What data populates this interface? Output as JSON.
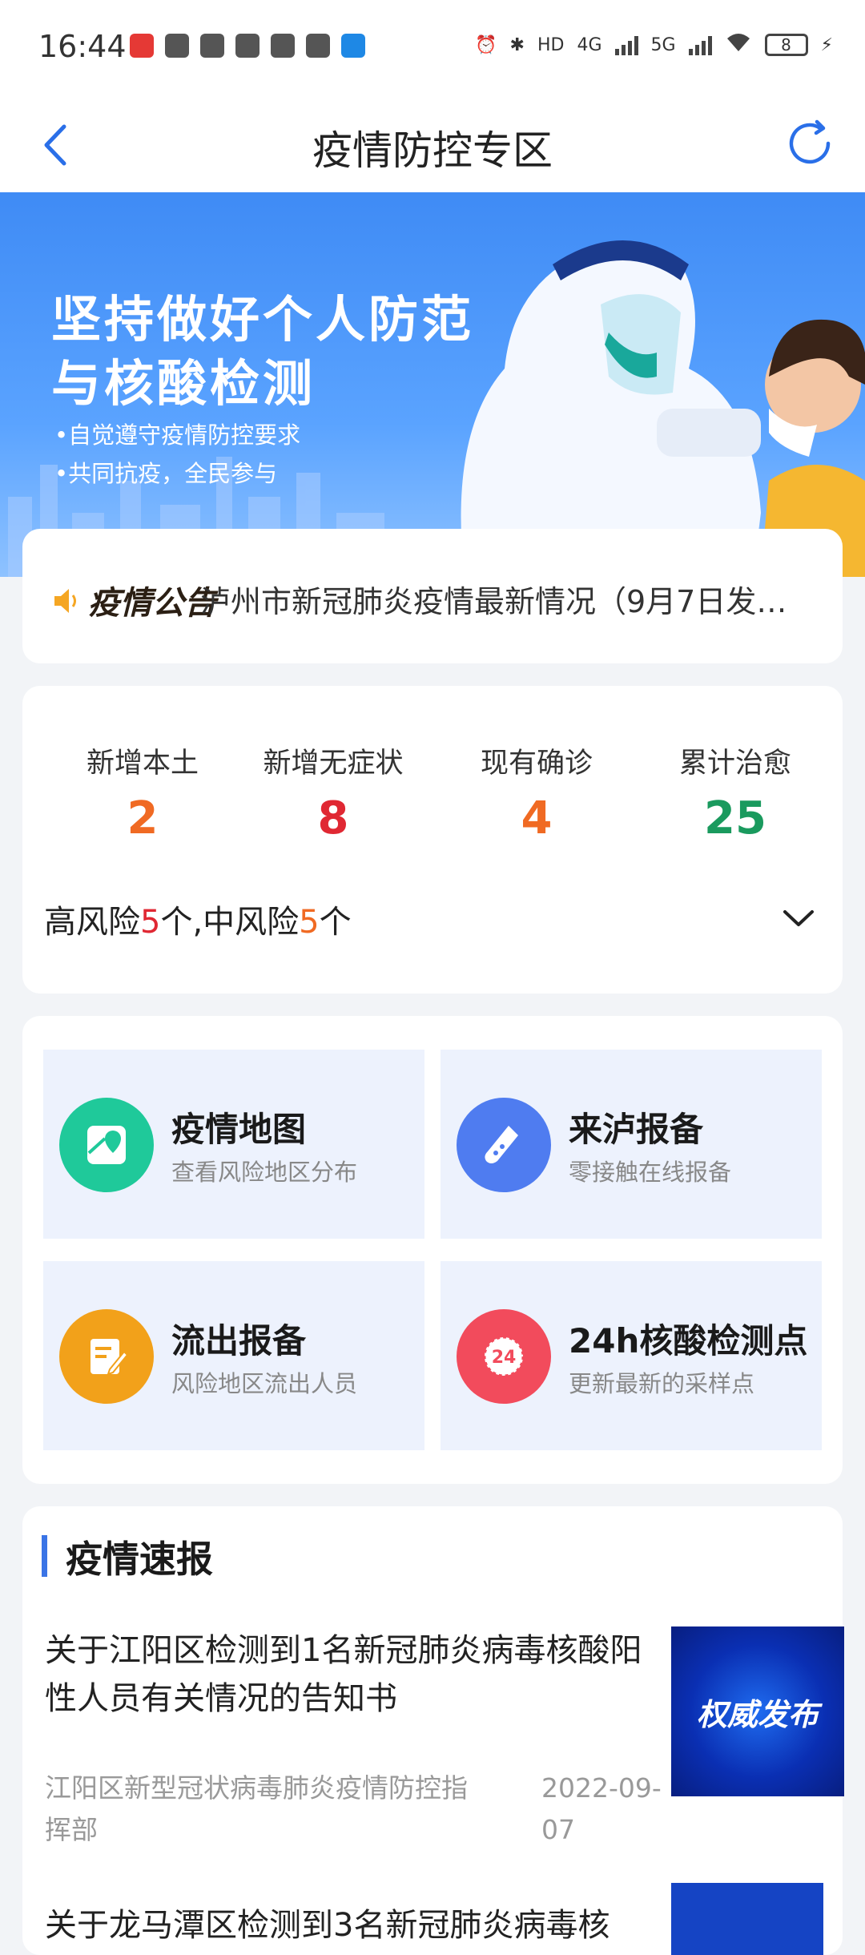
{
  "status_bar": {
    "time": "16:44",
    "battery": "8",
    "network_1": "HD",
    "network_2": "4G",
    "network_3": "5G"
  },
  "header": {
    "title": "疫情防控专区"
  },
  "banner": {
    "headline_1": "坚持做好个人防范",
    "headline_2": "与核酸检测",
    "bullet_1": "•自觉遵守疫情防控要求",
    "bullet_2": "•共同抗疫，全民参与"
  },
  "notice": {
    "label": "疫情公告",
    "text": "泸州市新冠肺炎疫情最新情况（9月7日发…"
  },
  "stats": {
    "items": [
      {
        "label": "新增本土",
        "value": "2",
        "color": "#f06a23"
      },
      {
        "label": "新增无症状",
        "value": "8",
        "color": "#e02833"
      },
      {
        "label": "现有确诊",
        "value": "4",
        "color": "#f06a23"
      },
      {
        "label": "累计治愈",
        "value": "25",
        "color": "#1a9a5e"
      }
    ],
    "risk_prefix": "高风险",
    "risk_high": "5",
    "risk_mid_text": "个,中风险",
    "risk_mid": "5",
    "risk_suffix": "个"
  },
  "services": [
    {
      "title": "疫情地图",
      "subtitle": "查看风险地区分布",
      "icon": "map-icon",
      "color": "#1fc99a"
    },
    {
      "title": "来泸报备",
      "subtitle": "零接触在线报备",
      "icon": "test-tube-icon",
      "color": "#4f7cf0"
    },
    {
      "title": "流出报备",
      "subtitle": "风险地区流出人员",
      "icon": "edit-document-icon",
      "color": "#f2a11a"
    },
    {
      "title": "24h核酸检测点",
      "subtitle": "更新最新的采样点",
      "icon": "24h-clock-icon",
      "color": "#f24b5c"
    }
  ],
  "news": {
    "section_title": "疫情速报",
    "items": [
      {
        "title": "关于江阳区检测到1名新冠肺炎病毒核酸阳性人员有关情况的告知书",
        "source": "江阳区新型冠状病毒肺炎疫情防控指挥部",
        "date": "2022-09-07",
        "thumb_text": "权威发布"
      },
      {
        "title": "关于龙马潭区检测到3名新冠肺炎病毒核"
      }
    ]
  }
}
